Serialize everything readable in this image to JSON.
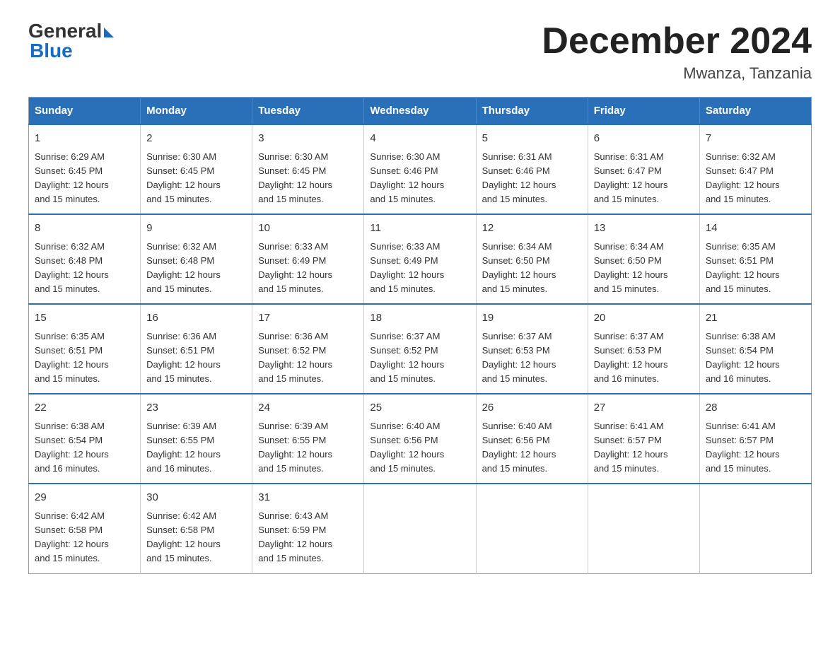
{
  "logo": {
    "general": "General",
    "blue": "Blue"
  },
  "title": "December 2024",
  "location": "Mwanza, Tanzania",
  "days_of_week": [
    "Sunday",
    "Monday",
    "Tuesday",
    "Wednesday",
    "Thursday",
    "Friday",
    "Saturday"
  ],
  "weeks": [
    [
      {
        "day": "1",
        "sunrise": "6:29 AM",
        "sunset": "6:45 PM",
        "daylight": "12 hours and 15 minutes."
      },
      {
        "day": "2",
        "sunrise": "6:30 AM",
        "sunset": "6:45 PM",
        "daylight": "12 hours and 15 minutes."
      },
      {
        "day": "3",
        "sunrise": "6:30 AM",
        "sunset": "6:45 PM",
        "daylight": "12 hours and 15 minutes."
      },
      {
        "day": "4",
        "sunrise": "6:30 AM",
        "sunset": "6:46 PM",
        "daylight": "12 hours and 15 minutes."
      },
      {
        "day": "5",
        "sunrise": "6:31 AM",
        "sunset": "6:46 PM",
        "daylight": "12 hours and 15 minutes."
      },
      {
        "day": "6",
        "sunrise": "6:31 AM",
        "sunset": "6:47 PM",
        "daylight": "12 hours and 15 minutes."
      },
      {
        "day": "7",
        "sunrise": "6:32 AM",
        "sunset": "6:47 PM",
        "daylight": "12 hours and 15 minutes."
      }
    ],
    [
      {
        "day": "8",
        "sunrise": "6:32 AM",
        "sunset": "6:48 PM",
        "daylight": "12 hours and 15 minutes."
      },
      {
        "day": "9",
        "sunrise": "6:32 AM",
        "sunset": "6:48 PM",
        "daylight": "12 hours and 15 minutes."
      },
      {
        "day": "10",
        "sunrise": "6:33 AM",
        "sunset": "6:49 PM",
        "daylight": "12 hours and 15 minutes."
      },
      {
        "day": "11",
        "sunrise": "6:33 AM",
        "sunset": "6:49 PM",
        "daylight": "12 hours and 15 minutes."
      },
      {
        "day": "12",
        "sunrise": "6:34 AM",
        "sunset": "6:50 PM",
        "daylight": "12 hours and 15 minutes."
      },
      {
        "day": "13",
        "sunrise": "6:34 AM",
        "sunset": "6:50 PM",
        "daylight": "12 hours and 15 minutes."
      },
      {
        "day": "14",
        "sunrise": "6:35 AM",
        "sunset": "6:51 PM",
        "daylight": "12 hours and 15 minutes."
      }
    ],
    [
      {
        "day": "15",
        "sunrise": "6:35 AM",
        "sunset": "6:51 PM",
        "daylight": "12 hours and 15 minutes."
      },
      {
        "day": "16",
        "sunrise": "6:36 AM",
        "sunset": "6:51 PM",
        "daylight": "12 hours and 15 minutes."
      },
      {
        "day": "17",
        "sunrise": "6:36 AM",
        "sunset": "6:52 PM",
        "daylight": "12 hours and 15 minutes."
      },
      {
        "day": "18",
        "sunrise": "6:37 AM",
        "sunset": "6:52 PM",
        "daylight": "12 hours and 15 minutes."
      },
      {
        "day": "19",
        "sunrise": "6:37 AM",
        "sunset": "6:53 PM",
        "daylight": "12 hours and 15 minutes."
      },
      {
        "day": "20",
        "sunrise": "6:37 AM",
        "sunset": "6:53 PM",
        "daylight": "12 hours and 16 minutes."
      },
      {
        "day": "21",
        "sunrise": "6:38 AM",
        "sunset": "6:54 PM",
        "daylight": "12 hours and 16 minutes."
      }
    ],
    [
      {
        "day": "22",
        "sunrise": "6:38 AM",
        "sunset": "6:54 PM",
        "daylight": "12 hours and 16 minutes."
      },
      {
        "day": "23",
        "sunrise": "6:39 AM",
        "sunset": "6:55 PM",
        "daylight": "12 hours and 16 minutes."
      },
      {
        "day": "24",
        "sunrise": "6:39 AM",
        "sunset": "6:55 PM",
        "daylight": "12 hours and 15 minutes."
      },
      {
        "day": "25",
        "sunrise": "6:40 AM",
        "sunset": "6:56 PM",
        "daylight": "12 hours and 15 minutes."
      },
      {
        "day": "26",
        "sunrise": "6:40 AM",
        "sunset": "6:56 PM",
        "daylight": "12 hours and 15 minutes."
      },
      {
        "day": "27",
        "sunrise": "6:41 AM",
        "sunset": "6:57 PM",
        "daylight": "12 hours and 15 minutes."
      },
      {
        "day": "28",
        "sunrise": "6:41 AM",
        "sunset": "6:57 PM",
        "daylight": "12 hours and 15 minutes."
      }
    ],
    [
      {
        "day": "29",
        "sunrise": "6:42 AM",
        "sunset": "6:58 PM",
        "daylight": "12 hours and 15 minutes."
      },
      {
        "day": "30",
        "sunrise": "6:42 AM",
        "sunset": "6:58 PM",
        "daylight": "12 hours and 15 minutes."
      },
      {
        "day": "31",
        "sunrise": "6:43 AM",
        "sunset": "6:59 PM",
        "daylight": "12 hours and 15 minutes."
      },
      null,
      null,
      null,
      null
    ]
  ],
  "labels": {
    "sunrise": "Sunrise:",
    "sunset": "Sunset:",
    "daylight": "Daylight:"
  }
}
